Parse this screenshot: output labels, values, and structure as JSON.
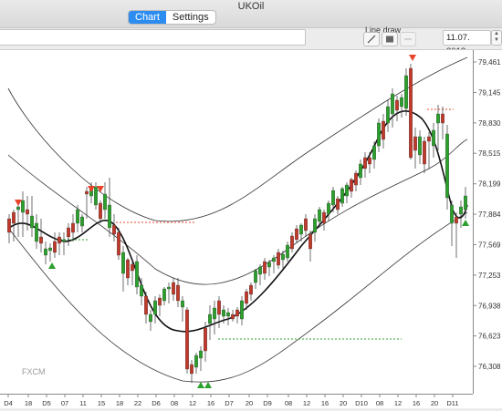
{
  "window": {
    "title": "UKOil"
  },
  "tabs": [
    {
      "label": "Chart",
      "active": true
    },
    {
      "label": "Settings",
      "active": false
    }
  ],
  "toolbar": {
    "symbol_value": "",
    "line_draw_label": "Line draw",
    "tools": [
      "pencil-icon",
      "square-icon",
      "minus-icon"
    ],
    "date_value": "11.07. 2018"
  },
  "chart_data": {
    "type": "candlestick",
    "watermark": "FXCM",
    "y_ticks": [
      "79,461",
      "79,145",
      "78,830",
      "78,515",
      "78,199",
      "77,884",
      "77,569",
      "77,253",
      "76,938",
      "76,623",
      "76,308"
    ],
    "y_range": [
      76.308,
      79.461
    ],
    "x_ticks": [
      "D4",
      "18",
      "D5",
      "07",
      "11",
      "15",
      "18",
      "22",
      "D6",
      "08",
      "12",
      "16",
      "D7",
      "20",
      "D9",
      "08",
      "12",
      "16",
      "20",
      "D10",
      "08",
      "12",
      "16",
      "20",
      "D11"
    ],
    "colors": {
      "up": "#2ca02c",
      "down": "#c0392b",
      "band": "#333333",
      "center": "#111111",
      "red_marker": "#e8442a",
      "green_marker": "#2ca02c"
    }
  }
}
